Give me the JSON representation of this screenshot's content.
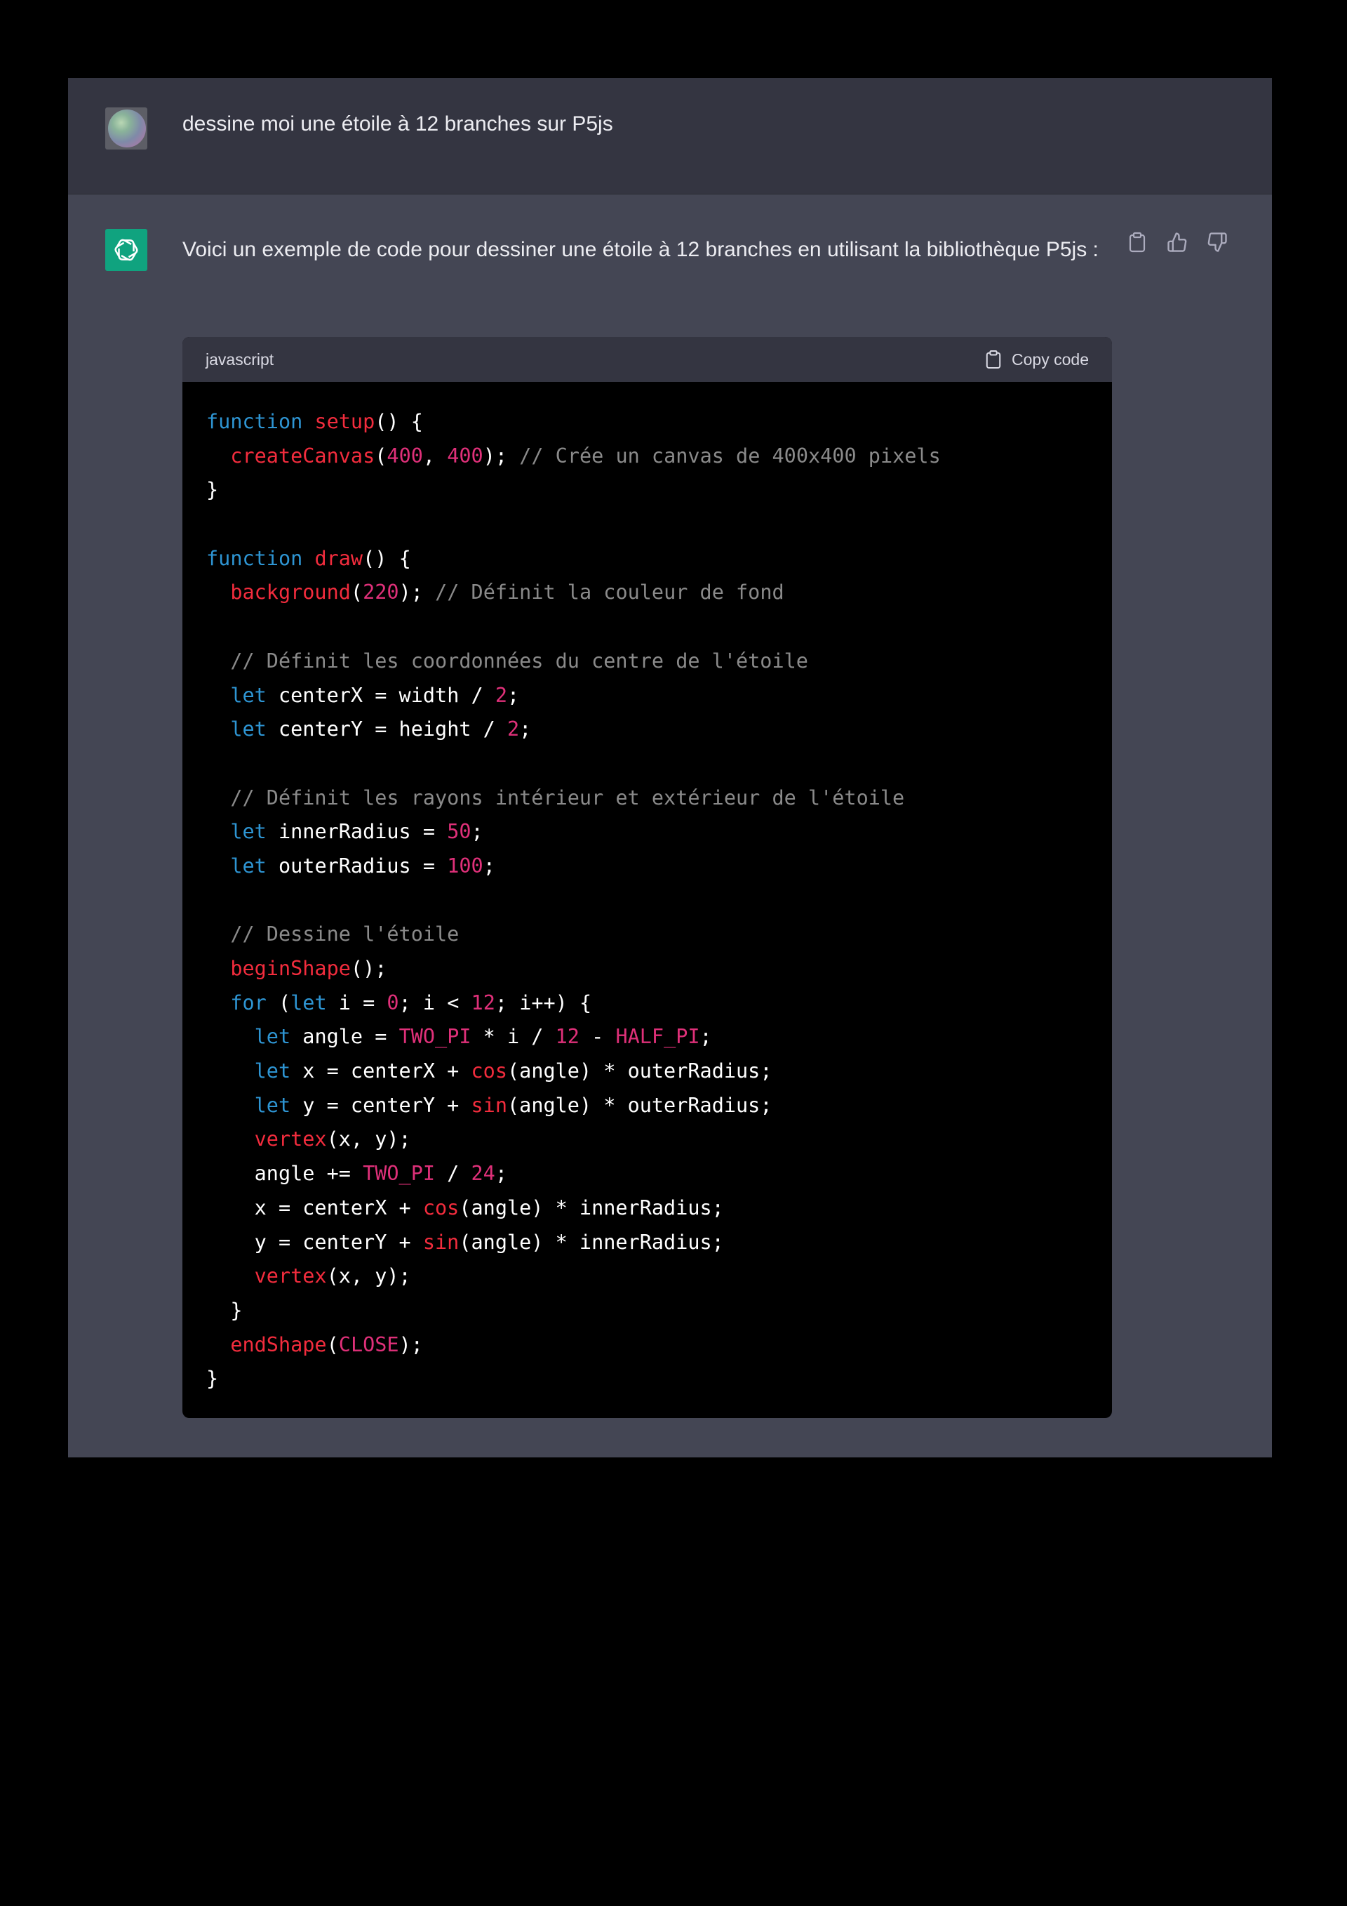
{
  "user_message": {
    "text": "dessine moi une étoile à 12 branches sur P5js"
  },
  "assistant_message": {
    "intro": "Voici un exemple de code pour dessiner une étoile à 12 branches en utilisant la bibliothèque P5js :",
    "actions": [
      {
        "name": "copy-icon"
      },
      {
        "name": "thumbs-up-icon"
      },
      {
        "name": "thumbs-down-icon"
      }
    ],
    "code_block": {
      "language": "javascript",
      "copy_label": "Copy code",
      "lines": [
        [
          [
            "kw",
            "function"
          ],
          [
            "pl",
            " "
          ],
          [
            "fn",
            "setup"
          ],
          [
            "pl",
            "() {"
          ]
        ],
        [
          [
            "pl",
            "  "
          ],
          [
            "fn",
            "createCanvas"
          ],
          [
            "pl",
            "("
          ],
          [
            "num",
            "400"
          ],
          [
            "pl",
            ", "
          ],
          [
            "num",
            "400"
          ],
          [
            "pl",
            "); "
          ],
          [
            "cm",
            "// Crée un canvas de 400x400 pixels"
          ]
        ],
        [
          [
            "pl",
            "}"
          ]
        ],
        [],
        [
          [
            "kw",
            "function"
          ],
          [
            "pl",
            " "
          ],
          [
            "fn",
            "draw"
          ],
          [
            "pl",
            "() {"
          ]
        ],
        [
          [
            "pl",
            "  "
          ],
          [
            "fn",
            "background"
          ],
          [
            "pl",
            "("
          ],
          [
            "num",
            "220"
          ],
          [
            "pl",
            "); "
          ],
          [
            "cm",
            "// Définit la couleur de fond"
          ]
        ],
        [],
        [
          [
            "pl",
            "  "
          ],
          [
            "cm",
            "// Définit les coordonnées du centre de l'étoile"
          ]
        ],
        [
          [
            "pl",
            "  "
          ],
          [
            "kw",
            "let"
          ],
          [
            "pl",
            " centerX = width / "
          ],
          [
            "num",
            "2"
          ],
          [
            "pl",
            ";"
          ]
        ],
        [
          [
            "pl",
            "  "
          ],
          [
            "kw",
            "let"
          ],
          [
            "pl",
            " centerY = height / "
          ],
          [
            "num",
            "2"
          ],
          [
            "pl",
            ";"
          ]
        ],
        [],
        [
          [
            "pl",
            "  "
          ],
          [
            "cm",
            "// Définit les rayons intérieur et extérieur de l'étoile"
          ]
        ],
        [
          [
            "pl",
            "  "
          ],
          [
            "kw",
            "let"
          ],
          [
            "pl",
            " innerRadius = "
          ],
          [
            "num",
            "50"
          ],
          [
            "pl",
            ";"
          ]
        ],
        [
          [
            "pl",
            "  "
          ],
          [
            "kw",
            "let"
          ],
          [
            "pl",
            " outerRadius = "
          ],
          [
            "num",
            "100"
          ],
          [
            "pl",
            ";"
          ]
        ],
        [],
        [
          [
            "pl",
            "  "
          ],
          [
            "cm",
            "// Dessine l'étoile"
          ]
        ],
        [
          [
            "pl",
            "  "
          ],
          [
            "fn",
            "beginShape"
          ],
          [
            "pl",
            "();"
          ]
        ],
        [
          [
            "pl",
            "  "
          ],
          [
            "kw",
            "for"
          ],
          [
            "pl",
            " ("
          ],
          [
            "kw",
            "let"
          ],
          [
            "pl",
            " i = "
          ],
          [
            "num",
            "0"
          ],
          [
            "pl",
            "; i < "
          ],
          [
            "num",
            "12"
          ],
          [
            "pl",
            "; i++) {"
          ]
        ],
        [
          [
            "pl",
            "    "
          ],
          [
            "kw",
            "let"
          ],
          [
            "pl",
            " angle = "
          ],
          [
            "const",
            "TWO_PI"
          ],
          [
            "pl",
            " * i / "
          ],
          [
            "num",
            "12"
          ],
          [
            "pl",
            " - "
          ],
          [
            "const",
            "HALF_PI"
          ],
          [
            "pl",
            ";"
          ]
        ],
        [
          [
            "pl",
            "    "
          ],
          [
            "kw",
            "let"
          ],
          [
            "pl",
            " x = centerX + "
          ],
          [
            "fn",
            "cos"
          ],
          [
            "pl",
            "(angle) * outerRadius;"
          ]
        ],
        [
          [
            "pl",
            "    "
          ],
          [
            "kw",
            "let"
          ],
          [
            "pl",
            " y = centerY + "
          ],
          [
            "fn",
            "sin"
          ],
          [
            "pl",
            "(angle) * outerRadius;"
          ]
        ],
        [
          [
            "pl",
            "    "
          ],
          [
            "fn",
            "vertex"
          ],
          [
            "pl",
            "(x, y);"
          ]
        ],
        [
          [
            "pl",
            "    angle += "
          ],
          [
            "const",
            "TWO_PI"
          ],
          [
            "pl",
            " / "
          ],
          [
            "num",
            "24"
          ],
          [
            "pl",
            ";"
          ]
        ],
        [
          [
            "pl",
            "    x = centerX + "
          ],
          [
            "fn",
            "cos"
          ],
          [
            "pl",
            "(angle) * innerRadius;"
          ]
        ],
        [
          [
            "pl",
            "    y = centerY + "
          ],
          [
            "fn",
            "sin"
          ],
          [
            "pl",
            "(angle) * innerRadius;"
          ]
        ],
        [
          [
            "pl",
            "    "
          ],
          [
            "fn",
            "vertex"
          ],
          [
            "pl",
            "(x, y);"
          ]
        ],
        [
          [
            "pl",
            "  }"
          ]
        ],
        [
          [
            "pl",
            "  "
          ],
          [
            "fn",
            "endShape"
          ],
          [
            "pl",
            "("
          ],
          [
            "const",
            "CLOSE"
          ],
          [
            "pl",
            ");"
          ]
        ],
        [
          [
            "pl",
            "}"
          ]
        ]
      ]
    }
  },
  "colors": {
    "page_background": "#000000",
    "user_row": "#343541",
    "assistant_row": "#444654",
    "openai_green": "#10a37f",
    "keyword": "#2e95d3",
    "function": "#f22c3d",
    "number": "#df3079",
    "comment": "#8a8a8a"
  }
}
